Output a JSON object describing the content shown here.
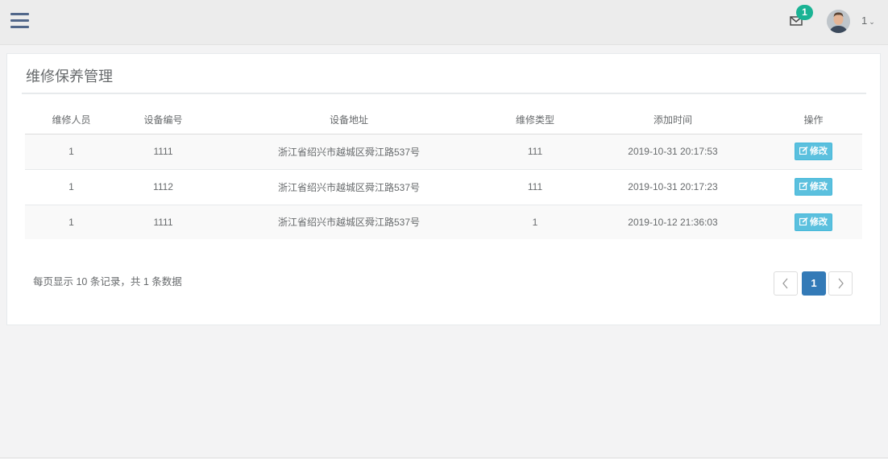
{
  "topbar": {
    "notification_count": "1",
    "user_name": "1"
  },
  "panel": {
    "title": "维修保养管理"
  },
  "table": {
    "headers": [
      "维修人员",
      "设备编号",
      "设备地址",
      "维修类型",
      "添加时间",
      "操作"
    ],
    "rows": [
      {
        "person": "1",
        "device_no": "1111",
        "address": "浙江省绍兴市越城区舜江路537号",
        "type": "111",
        "added": "2019-10-31 20:17:53",
        "action": "修改"
      },
      {
        "person": "1",
        "device_no": "1112",
        "address": "浙江省绍兴市越城区舜江路537号",
        "type": "111",
        "added": "2019-10-31 20:17:23",
        "action": "修改"
      },
      {
        "person": "1",
        "device_no": "1111",
        "address": "浙江省绍兴市越城区舜江路537号",
        "type": "1",
        "added": "2019-10-12 21:36:03",
        "action": "修改"
      }
    ]
  },
  "footer": {
    "info": "每页显示 10 条记录，共 1 条数据"
  },
  "pagination": {
    "current_page": "1"
  },
  "colors": {
    "badge": "#1ab394",
    "edit_button": "#5bc0de",
    "active_page": "#337ab7",
    "hamburger": "#51678a"
  },
  "icons": [
    "hamburger-icon",
    "mail-icon",
    "chevron-down-icon",
    "edit-icon",
    "chevron-left-icon",
    "chevron-right-icon"
  ]
}
